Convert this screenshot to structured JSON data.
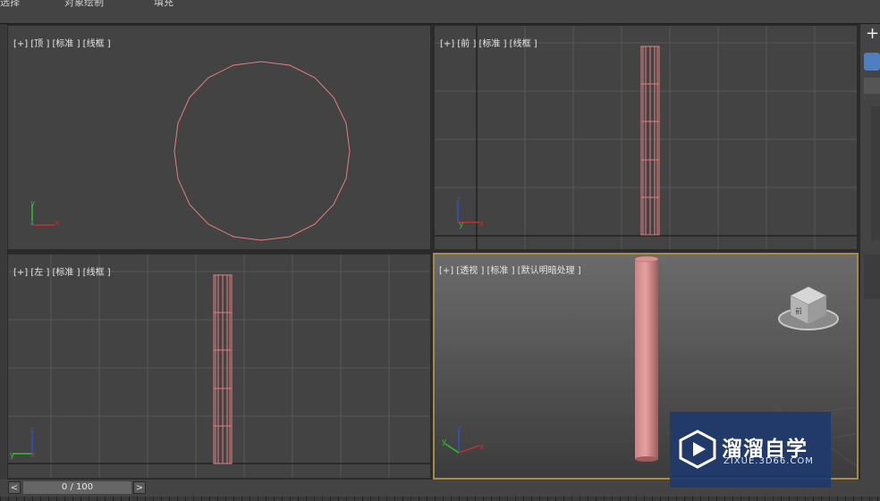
{
  "menu": {
    "items": [
      "选择",
      "对象绘制",
      "填充"
    ]
  },
  "viewports": {
    "top": {
      "label": "[+] [顶 ] [标准 ] [线框 ]"
    },
    "front": {
      "label": "[+] [前 ] [标准 ] [线框 ]"
    },
    "left": {
      "label": "[+] [左 ] [标准 ] [线框 ]"
    },
    "perspective": {
      "label": "[+] [透视 ] [标准 ] [默认明暗处理 ]",
      "viewcube_face": "前"
    }
  },
  "axes": {
    "x": "x",
    "y": "y",
    "z": "z"
  },
  "timeline": {
    "prev": "<",
    "next": ">",
    "frame": "0 / 100"
  },
  "watermark": {
    "name": "溜溜自学",
    "url": "ZIXUE.3D66.COM"
  },
  "colors": {
    "object": "#e07f7f",
    "viewport_bg": "#434343",
    "active_border": "#a58a4a"
  }
}
